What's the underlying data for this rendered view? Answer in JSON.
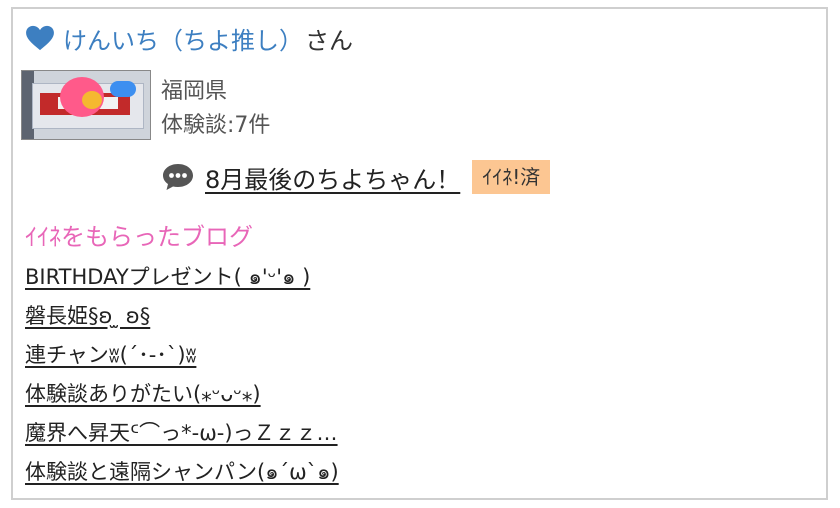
{
  "user": {
    "name": "けんいち（ちよ推し）",
    "suffix": "さん",
    "heart_color": "#3d7fc1"
  },
  "profile": {
    "location": "福岡県",
    "experience_count": "体験談:7件"
  },
  "post": {
    "title": "8月最後のちよちゃん！",
    "like_badge": "ｲｲﾈ!済",
    "badge_color": "#fcc692"
  },
  "liked_blogs": {
    "heading": "ｲｲﾈをもらったブログ",
    "heading_color": "#e866b8",
    "items": [
      "BIRTHDAYプレゼント( ๑'ᵕ'๑ )",
      "磐長姫§ʚ ̫ ʚ§",
      "連チャンʬ(´･-･`)ʬ",
      "体験談ありがたい(⁎ᵕᴗᵕ⁎)",
      "魔界へ昇天ᑦ⌒っ*-ω-)っＺｚｚ…",
      "体験談と遠隔シャンパン(๑´ω`๑)"
    ]
  }
}
